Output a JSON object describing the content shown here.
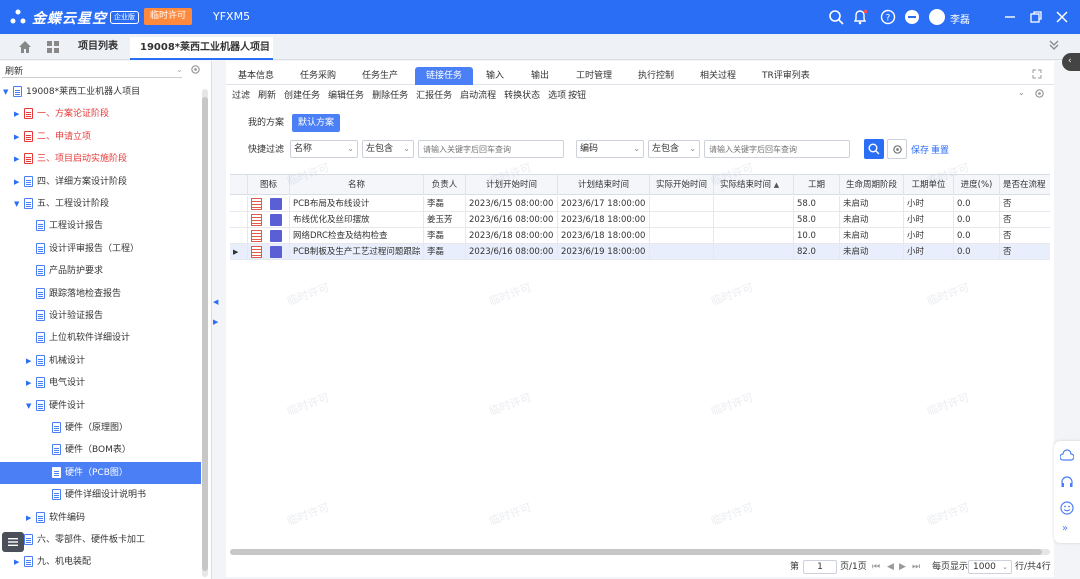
{
  "topbar": {
    "brand": "金蝶云星空",
    "edition": "企业版",
    "license_button": "临时许可",
    "tenant": "YFXM5",
    "user_name": "李磊"
  },
  "tabs": {
    "project_list": "项目列表",
    "active_tab": "19008*莱西工业机器人项目",
    "close": "×"
  },
  "left_panel": {
    "search_value": "刷新",
    "tree": [
      {
        "label": "19008*莱西工业机器人项目",
        "level": 0,
        "arrow": "▼",
        "style": "normal"
      },
      {
        "label": "一、方案论证阶段",
        "level": 1,
        "arrow": "▶",
        "style": "red"
      },
      {
        "label": "二、申请立项",
        "level": 1,
        "arrow": "▶",
        "style": "red"
      },
      {
        "label": "三、项目启动实施阶段",
        "level": 1,
        "arrow": "▶",
        "style": "red"
      },
      {
        "label": "四、详细方案设计阶段",
        "level": 1,
        "arrow": "▶",
        "style": "normal"
      },
      {
        "label": "五、工程设计阶段",
        "level": 1,
        "arrow": "▼",
        "style": "normal"
      },
      {
        "label": "工程设计报告",
        "level": 2,
        "arrow": "",
        "style": "normal"
      },
      {
        "label": "设计评审报告（工程）",
        "level": 2,
        "arrow": "",
        "style": "normal"
      },
      {
        "label": "产品防护要求",
        "level": 2,
        "arrow": "",
        "style": "normal"
      },
      {
        "label": "跟踪落地检查报告",
        "level": 2,
        "arrow": "",
        "style": "normal"
      },
      {
        "label": "设计验证报告",
        "level": 2,
        "arrow": "",
        "style": "normal"
      },
      {
        "label": "上位机软件详细设计",
        "level": 2,
        "arrow": "",
        "style": "normal"
      },
      {
        "label": "机械设计",
        "level": 2,
        "arrow": "▶",
        "style": "normal"
      },
      {
        "label": "电气设计",
        "level": 2,
        "arrow": "▶",
        "style": "normal"
      },
      {
        "label": "硬件设计",
        "level": 2,
        "arrow": "▼",
        "style": "normal"
      },
      {
        "label": "硬件（原理图）",
        "level": 3,
        "arrow": "",
        "style": "normal"
      },
      {
        "label": "硬件（BOM表）",
        "level": 3,
        "arrow": "",
        "style": "normal"
      },
      {
        "label": "硬件（PCB图）",
        "level": 3,
        "arrow": "",
        "style": "selected"
      },
      {
        "label": "硬件详细设计说明书",
        "level": 3,
        "arrow": "",
        "style": "normal"
      },
      {
        "label": "软件编码",
        "level": 2,
        "arrow": "▶",
        "style": "normal"
      },
      {
        "label": "六、零部件、硬件板卡加工",
        "level": 1,
        "arrow": "▶",
        "style": "normal"
      },
      {
        "label": "九、机电装配",
        "level": 1,
        "arrow": "▶",
        "style": "normal"
      }
    ]
  },
  "subtabs": [
    "基本信息",
    "任务采购",
    "任务生产",
    "链接任务",
    "输入",
    "输出",
    "工时管理",
    "执行控制",
    "相关过程",
    "TR评审列表"
  ],
  "toolbar": [
    "过滤",
    "刷新",
    "创建任务",
    "编辑任务",
    "删除任务",
    "汇报任务",
    "启动流程",
    "转换状态",
    "选项",
    "按钮"
  ],
  "schemes": {
    "mine": "我的方案",
    "default": "默认方案"
  },
  "filter": {
    "label": "快捷过滤",
    "field1": "名称",
    "op1": "左包含",
    "placeholder1": "请输入关键字后回车查询",
    "field2": "编码",
    "op2": "左包含",
    "placeholder2": "请输入关键字后回车查询",
    "save": "保存",
    "reset": "重置"
  },
  "grid": {
    "columns": [
      "图标",
      "名称",
      "负责人",
      "计划开始时间",
      "计划结束时间",
      "实际开始时间",
      "实际结束时间",
      "工期",
      "生命周期阶段",
      "工期单位",
      "进度(%)",
      "是否在流程"
    ],
    "sort_indicator": "▲",
    "rows": [
      {
        "name": "PCB布局及布线设计",
        "owner": "李磊",
        "plan_start": "2023/6/15 08:00:00",
        "plan_end": "2023/6/17 18:00:00",
        "act_start": "",
        "act_end": "",
        "duration": "58.0",
        "phase": "未启动",
        "unit": "小时",
        "progress": "0.0",
        "in_flow": "否"
      },
      {
        "name": "布线优化及丝印摆放",
        "owner": "姜玉芳",
        "plan_start": "2023/6/16 08:00:00",
        "plan_end": "2023/6/18 18:00:00",
        "act_start": "",
        "act_end": "",
        "duration": "58.0",
        "phase": "未启动",
        "unit": "小时",
        "progress": "0.0",
        "in_flow": "否"
      },
      {
        "name": "网络DRC检查及结构检查",
        "owner": "李磊",
        "plan_start": "2023/6/18 08:00:00",
        "plan_end": "2023/6/18 18:00:00",
        "act_start": "",
        "act_end": "",
        "duration": "10.0",
        "phase": "未启动",
        "unit": "小时",
        "progress": "0.0",
        "in_flow": "否"
      },
      {
        "name": "PCB制板及生产工艺过程问题跟踪",
        "owner": "李磊",
        "plan_start": "2023/6/16 08:00:00",
        "plan_end": "2023/6/19 18:00:00",
        "act_start": "",
        "act_end": "",
        "duration": "82.0",
        "phase": "未启动",
        "unit": "小时",
        "progress": "0.0",
        "in_flow": "否"
      }
    ]
  },
  "pager": {
    "page_label": "第",
    "page_value": "1",
    "total_pages": "页/1页",
    "per_page_label": "每页显示",
    "per_page_value": "1000",
    "rows_info": "行/共4行"
  },
  "watermark": "临时许可",
  "colors": {
    "brand": "#2b6ef6",
    "license": "#ff8a3d",
    "selected": "#4b7ff5",
    "danger": "#e53a3a"
  }
}
